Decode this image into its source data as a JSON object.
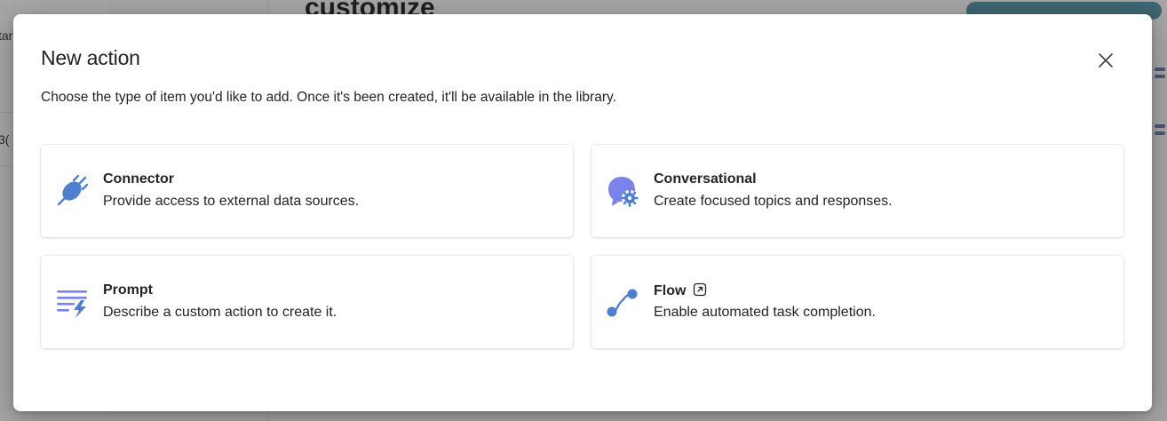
{
  "background": {
    "left_partial_1": "tar",
    "left_partial_2": "3(",
    "heading_partial": "customize"
  },
  "dialog": {
    "title": "New action",
    "description": "Choose the type of item you'd like to add. Once it's been created, it'll be available in the library.",
    "close_icon": "close-icon",
    "options": [
      {
        "title": "Connector",
        "description": "Provide access to external data sources.",
        "icon": "plug-icon"
      },
      {
        "title": "Conversational",
        "description": "Create focused topics and responses.",
        "icon": "chat-gear-icon"
      },
      {
        "title": "Prompt",
        "description": "Describe a custom action to create it.",
        "icon": "prompt-lightning-icon"
      },
      {
        "title": "Flow",
        "description": "Enable automated task completion.",
        "icon": "flow-icon",
        "external_link_icon": "open-external-icon"
      }
    ]
  },
  "colors": {
    "icon_blue": "#4f7fd0",
    "icon_purple": "#7b83eb",
    "text_primary": "#242424",
    "overlay": "#a2a2a2"
  }
}
